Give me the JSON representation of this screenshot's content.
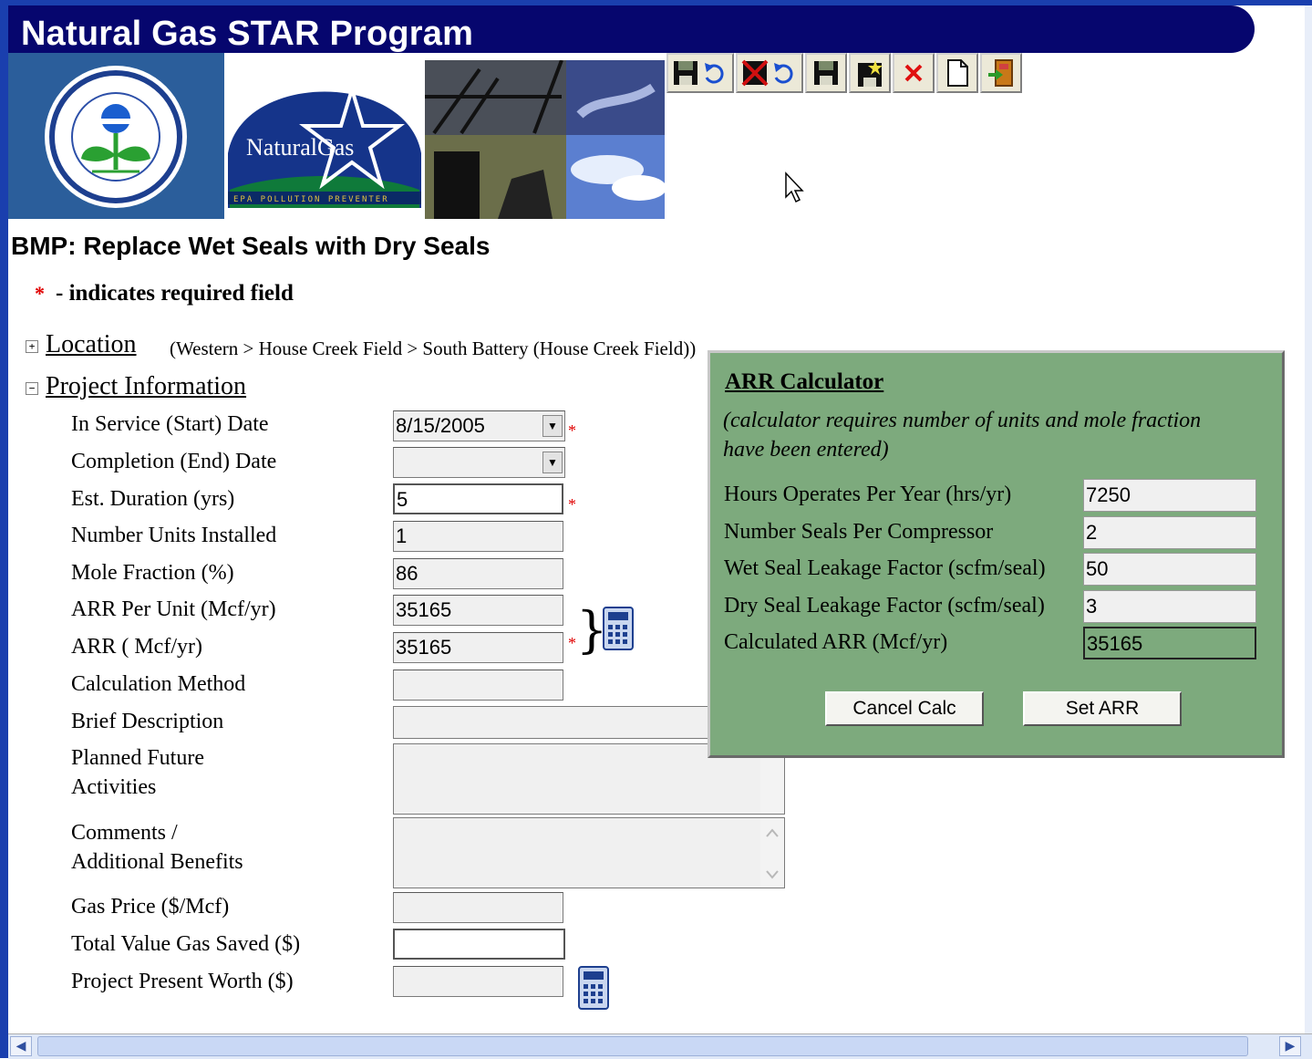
{
  "app": {
    "title": "Natural Gas STAR Program",
    "banner_logo_text": "NaturalGas",
    "banner_subtext": "EPA POLLUTION PREVENTER",
    "epa_seal_text": "UNITED STATES ENVIRONMENTAL PROTECTION AGENCY"
  },
  "toolbar": {
    "buttons": [
      {
        "icon": "save-undo-icon"
      },
      {
        "icon": "delete-undo-icon"
      },
      {
        "icon": "save-icon"
      },
      {
        "icon": "save-new-icon"
      },
      {
        "icon": "delete-icon"
      },
      {
        "icon": "new-document-icon"
      },
      {
        "icon": "exit-icon"
      }
    ]
  },
  "page": {
    "heading": "BMP: Replace Wet Seals with Dry Seals",
    "required_note": "- indicates required field",
    "required_marker": "*"
  },
  "location": {
    "toggle": "+",
    "title": "Location",
    "breadcrumb": "(Western > House Creek Field > South Battery (House Creek Field))"
  },
  "project": {
    "toggle": "−",
    "title": "Project Information",
    "fields": {
      "in_service_label": "In Service (Start) Date",
      "in_service_value": "8/15/2005",
      "completion_label": "Completion (End) Date",
      "completion_value": "",
      "duration_label": "Est. Duration (yrs)",
      "duration_value": "5",
      "units_label": "Number Units Installed",
      "units_value": "1",
      "mole_label": "Mole Fraction (%)",
      "mole_value": "86",
      "arr_unit_label": "ARR Per Unit (Mcf/yr)",
      "arr_unit_value": "35165",
      "arr_label": "ARR ( Mcf/yr)",
      "arr_value": "35165",
      "calc_method_label": "Calculation Method",
      "calc_method_value": "",
      "brief_label": "Brief Description",
      "planned_label_1": "Planned Future",
      "planned_label_2": "Activities",
      "comments_label_1": "Comments /",
      "comments_label_2": "Additional Benefits",
      "gas_price_label": "Gas Price ($/Mcf)",
      "gas_price_value": "",
      "total_value_label": "Total Value Gas Saved ($)",
      "total_value_value": "",
      "present_worth_label": "Project Present Worth ($)",
      "present_worth_value": ""
    }
  },
  "calculator": {
    "title": "ARR Calculator",
    "note": "(calculator requires number of units and mole fraction have been entered)",
    "hours_label": "Hours Operates Per Year (hrs/yr)",
    "hours_value": "7250",
    "seals_label": "Number Seals Per Compressor",
    "seals_value": "2",
    "wet_label": "Wet Seal Leakage Factor (scfm/seal)",
    "wet_value": "50",
    "dry_label": "Dry Seal Leakage Factor (scfm/seal)",
    "dry_value": "3",
    "calc_label": "Calculated ARR (Mcf/yr)",
    "calc_value": "35165",
    "cancel_label": "Cancel Calc",
    "set_label": "Set ARR"
  },
  "colors": {
    "title_bar": "#06066e",
    "popup_bg": "#7daa7d",
    "required": "#e00000"
  }
}
